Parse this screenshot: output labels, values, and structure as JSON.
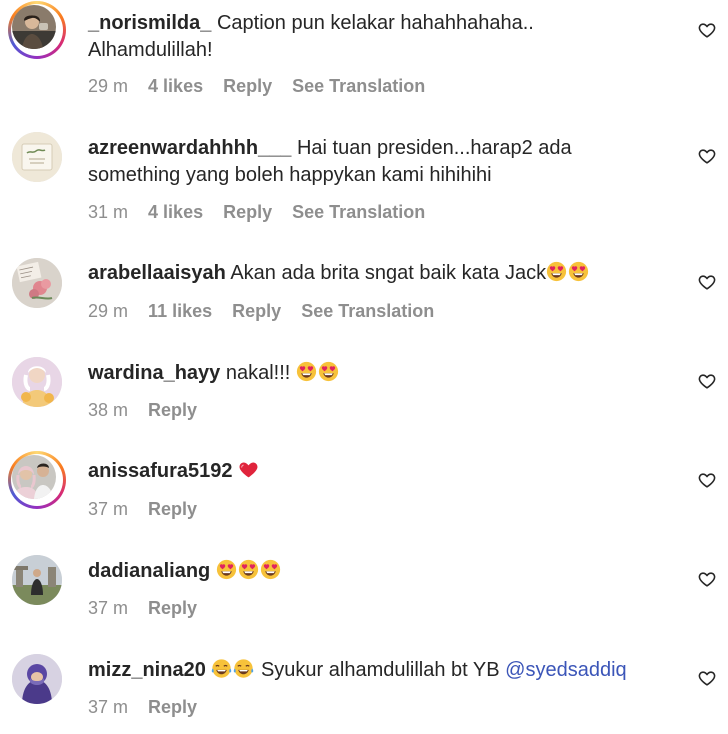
{
  "comments": [
    {
      "username": "_norismilda_",
      "text": "Caption pun kelakar hahahhahaha..",
      "text2": "Alhamdulillah!",
      "time": "29 m",
      "likes": "4 likes",
      "reply": "Reply",
      "translation": "See Translation",
      "story_ring": true
    },
    {
      "username": "azreenwardahhhh___",
      "text": "Hai tuan presiden...harap2 ada",
      "text2": "something yang boleh happykan kami hihihihi",
      "time": "31 m",
      "likes": "4 likes",
      "reply": "Reply",
      "translation": "See Translation"
    },
    {
      "username": "arabellaaisyah",
      "text": "Akan ada brita sngat baik kata Jack",
      "emojis": [
        "heart-eyes-emoji",
        "heart-eyes-emoji"
      ],
      "time": "29 m",
      "likes": "11 likes",
      "reply": "Reply",
      "translation": "See Translation"
    },
    {
      "username": "wardina_hayy",
      "text": "nakal!!!",
      "emojis": [
        "heart-eyes-emoji",
        "heart-eyes-emoji"
      ],
      "time": "38 m",
      "reply": "Reply"
    },
    {
      "username": "anissafura5192",
      "emojis": [
        "red-heart-emoji"
      ],
      "time": "37 m",
      "reply": "Reply",
      "story_ring": true
    },
    {
      "username": "dadianaliang",
      "emojis": [
        "heart-eyes-emoji",
        "heart-eyes-emoji",
        "heart-eyes-emoji"
      ],
      "time": "37 m",
      "reply": "Reply"
    },
    {
      "username": "mizz_nina20",
      "emojis_before": [
        "tears-of-joy-emoji",
        "tears-of-joy-emoji"
      ],
      "text": "Syukur alhamdulillah bt YB",
      "mention": "@syedsaddiq",
      "time": "37 m",
      "reply": "Reply"
    }
  ],
  "colors": {
    "text": "#262626",
    "meta": "#8e8e8e",
    "mention": "#3b55b8"
  }
}
